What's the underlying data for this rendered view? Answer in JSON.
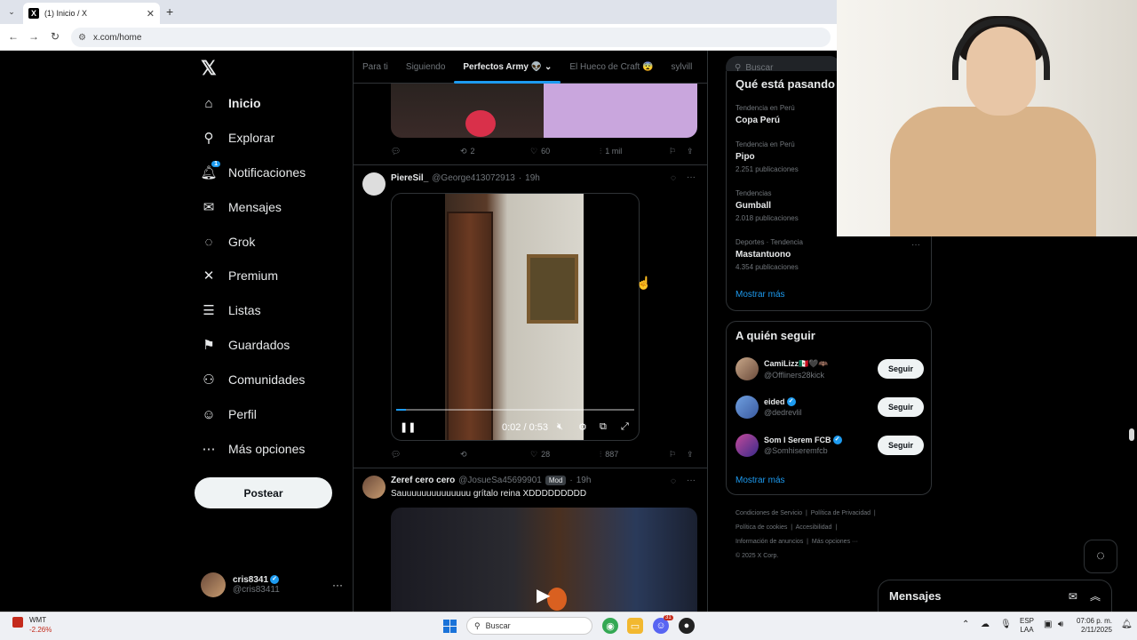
{
  "browser": {
    "tab_title": "(1) Inicio / X",
    "address": "x.com/home"
  },
  "nav": {
    "items": [
      {
        "label": "Inicio",
        "icon": "home-icon",
        "glyph": "⌂"
      },
      {
        "label": "Explorar",
        "icon": "search-icon",
        "glyph": "⚲"
      },
      {
        "label": "Notificaciones",
        "icon": "bell-icon",
        "glyph": "🔔︎"
      },
      {
        "label": "Mensajes",
        "icon": "mail-icon",
        "glyph": "✉"
      },
      {
        "label": "Grok",
        "icon": "grok-icon",
        "glyph": "◌"
      },
      {
        "label": "Premium",
        "icon": "x-premium-icon",
        "glyph": "✕"
      },
      {
        "label": "Listas",
        "icon": "list-icon",
        "glyph": "☰"
      },
      {
        "label": "Guardados",
        "icon": "bookmark-icon",
        "glyph": "⚑"
      },
      {
        "label": "Comunidades",
        "icon": "communities-icon",
        "glyph": "⚇"
      },
      {
        "label": "Perfil",
        "icon": "profile-icon",
        "glyph": "☺"
      },
      {
        "label": "Más opciones",
        "icon": "more-icon",
        "glyph": "⋯"
      }
    ],
    "notif_count": "1",
    "post_button": "Postear",
    "user": {
      "name": "cris8341",
      "handle": "@cris83411"
    }
  },
  "feed": {
    "tabs": [
      "Para ti",
      "Siguiendo",
      "Perfectos Army 👽",
      "El Hueco de Craft 😨",
      "sylvill"
    ],
    "post1": {
      "replies": "",
      "reposts": "2",
      "likes": "60",
      "views": "1 mil"
    },
    "post2": {
      "name": "PiereSil_",
      "handle": "@George413072913",
      "time": "19h",
      "video_time": "0:02 / 0:53",
      "video_progress": 0.04,
      "reposts": "",
      "likes": "28",
      "views": "887"
    },
    "post3": {
      "name": "Zeref cero cero",
      "handle": "@JosueSa45699901",
      "badge": "Mod",
      "time": "19h",
      "text": "Sauuuuuuuuuuuuuu grítalo reina XDDDDDDDDD"
    }
  },
  "right": {
    "search_placeholder": "Buscar",
    "trends_title": "Qué está pasando",
    "trends": [
      {
        "context": "Tendencia en Perú",
        "name": "Copa Perú",
        "count": ""
      },
      {
        "context": "Tendencia en Perú",
        "name": "Pipo",
        "count": "2.251 publicaciones"
      },
      {
        "context": "Tendencias",
        "name": "Gumball",
        "count": "2.018 publicaciones"
      },
      {
        "context": "Deportes · Tendencia",
        "name": "Mastantuono",
        "count": "4.354 publicaciones"
      }
    ],
    "show_more": "Mostrar más",
    "who_title": "A quién seguir",
    "follow": [
      {
        "name": "CamiLizz🇲🇽🖤🦇",
        "handle": "@Offliners28kick",
        "button": "Seguir"
      },
      {
        "name": "eided",
        "handle": "@dedrevlil",
        "button": "Seguir"
      },
      {
        "name": "Som I Serem FCB",
        "handle": "@Somhiseremfcb",
        "button": "Seguir"
      }
    ],
    "footer": [
      "Condiciones de Servicio",
      "Política de Privacidad",
      "Política de cookies",
      "Accesibilidad",
      "Información de anuncios",
      "Más opciones ···",
      "© 2025 X Corp."
    ],
    "messages": "Mensajes"
  },
  "taskbar": {
    "stock_name": "WMT",
    "stock_change": "-2.26%",
    "search": "Buscar",
    "lang1": "ESP",
    "lang2": "LAA",
    "time": "07:06 p. m.",
    "date": "2/11/2025",
    "discord_badge": "31"
  },
  "colors": {
    "accent": "#1d9bf0",
    "background": "#000000",
    "text": "#e7e9ea",
    "muted": "#71767b"
  }
}
